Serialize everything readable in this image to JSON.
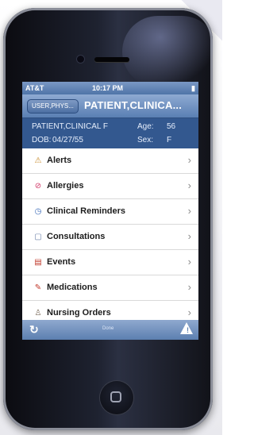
{
  "status_bar": {
    "carrier": "AT&T",
    "time": "10:17 PM",
    "battery": ""
  },
  "nav": {
    "back_label": "USER,PHYS...",
    "title": "PATIENT,CLINICA..."
  },
  "patient": {
    "name": "PATIENT,CLINICAL F",
    "age_label": "Age:",
    "age": "56",
    "dob_label": "DOB:",
    "dob": "04/27/55",
    "sex_label": "Sex:",
    "sex": "F"
  },
  "menu": {
    "items": [
      {
        "label": "Alerts",
        "icon": "alert-icon",
        "color": "#c78a2a"
      },
      {
        "label": "Allergies",
        "icon": "allergy-icon",
        "color": "#d23a6a"
      },
      {
        "label": "Clinical Reminders",
        "icon": "reminder-icon",
        "color": "#3a6ab8"
      },
      {
        "label": "Consultations",
        "icon": "consultation-icon",
        "color": "#6a7fa8"
      },
      {
        "label": "Events",
        "icon": "calendar-icon",
        "color": "#c0392b"
      },
      {
        "label": "Medications",
        "icon": "medication-icon",
        "color": "#c0392b"
      },
      {
        "label": "Nursing Orders",
        "icon": "nursing-icon",
        "color": "#7a6a5a"
      }
    ]
  },
  "toolbar": {
    "done_label": "Done"
  },
  "colors": {
    "nav_bar": "#5a7fb3",
    "patient_header": "#33588f",
    "toolbar": "#5c7fb0"
  }
}
